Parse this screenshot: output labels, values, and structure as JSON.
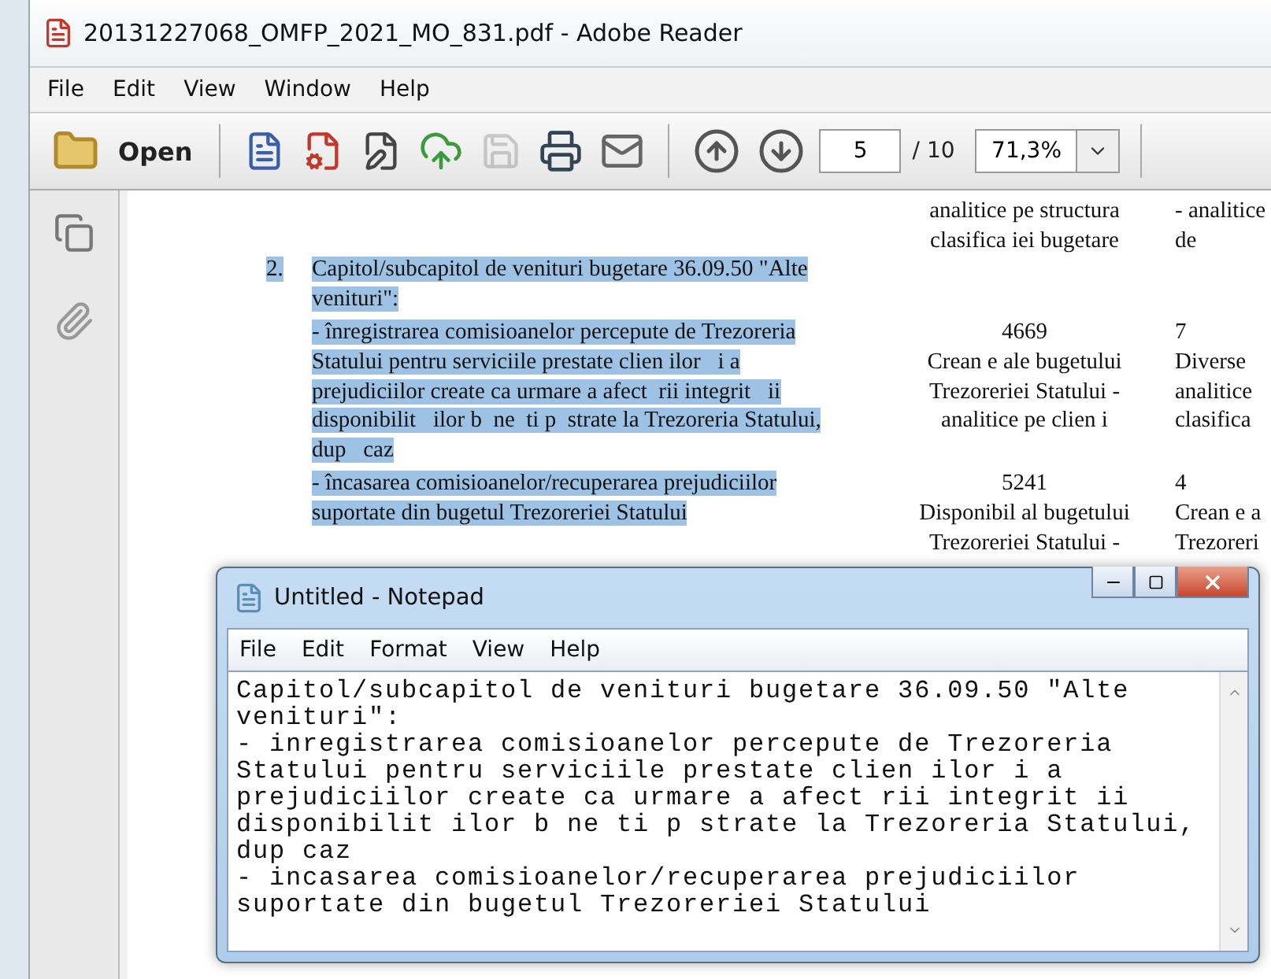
{
  "window": {
    "title": "20131227068_OMFP_2021_MO_831.pdf - Adobe Reader"
  },
  "menu": [
    {
      "label": "File"
    },
    {
      "label": "Edit"
    },
    {
      "label": "View"
    },
    {
      "label": "Window"
    },
    {
      "label": "Help"
    }
  ],
  "toolbar": {
    "open_label": "Open",
    "tools": [
      {
        "kind": "create",
        "disabled": false
      },
      {
        "kind": "settings",
        "disabled": false
      },
      {
        "kind": "sign",
        "disabled": false
      },
      {
        "kind": "upload",
        "disabled": false
      },
      {
        "kind": "save",
        "disabled": true
      },
      {
        "kind": "print",
        "disabled": false
      },
      {
        "kind": "mail",
        "disabled": false
      }
    ],
    "page_field": {
      "value": "5"
    },
    "page_total": "/ 10",
    "zoom_field": {
      "value": "71,3%"
    }
  },
  "document": {
    "top_row": {
      "column_2": [
        "analitice pe structura",
        "clasifica iei bugetare"
      ],
      "column_3": [
        "- analitice",
        "de"
      ]
    },
    "item": {
      "number": "2.",
      "highlighted": true,
      "heading": [
        "Capitol/subcapitol de venituri bugetare 36.09.50 \"Alte",
        "venituri\":"
      ],
      "rows": [
        {
          "text": [
            "- înregistrarea comisioanelor percepute de Trezoreria",
            "Statului pentru serviciile prestate clien ilor   i a",
            "prejudiciilor create ca urmare a afect  rii integrit   ii",
            "disponibilit   ilor b  ne  ti p  strate la Trezoreria Statului,",
            "dup   caz"
          ],
          "column_2": [
            "4669",
            "Crean e ale bugetului",
            "Trezoreriei Statului -",
            "analitice pe clien i"
          ],
          "column_3": [
            "7",
            "Diverse",
            "analitice",
            "clasifica"
          ]
        },
        {
          "text": [
            "- încasarea comisioanelor/recuperarea prejudiciilor",
            "suportate din bugetul Trezoreriei Statului"
          ],
          "column_2": [
            "5241",
            "Disponibil al bugetului",
            "Trezoreriei Statului -"
          ],
          "column_3": [
            "4",
            "Crean e a",
            "Trezoreri"
          ]
        }
      ]
    }
  },
  "notepad": {
    "title": "Untitled - Notepad",
    "menu": [
      {
        "label": "File"
      },
      {
        "label": "Edit"
      },
      {
        "label": "Format"
      },
      {
        "label": "View"
      },
      {
        "label": "Help"
      }
    ],
    "text": "Capitol/subcapitol de venituri bugetare 36.09.50 \"Alte\nvenituri\":\n- inregistrarea comisioanelor percepute de Trezoreria\nStatului pentru serviciile prestate clien ilor i a\nprejudiciilor create ca urmare a afect rii integrit ii\ndisponibilit ilor b ne ti p strate la Trezoreria Statului,\ndup caz\n- incasarea comisioanelor/recuperarea prejudiciilor\nsuportate din bugetul Trezoreriei Statului"
  }
}
